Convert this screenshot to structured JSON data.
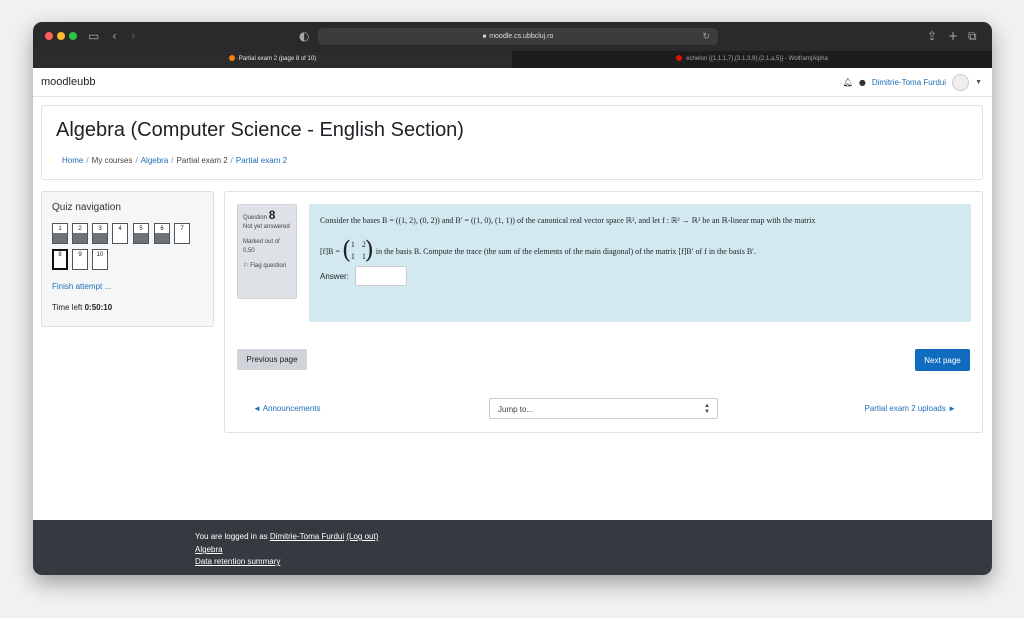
{
  "browser": {
    "url": "moodle.cs.ubbcluj.ro",
    "tabs": [
      {
        "label": "Partial exam 2 (page 8 of 10)",
        "active": true
      },
      {
        "label": "echelon {{1,1,1,7},{3,1,3,9},{2,1,a,5}} - Wolfram|Alpha",
        "active": false
      }
    ]
  },
  "navbar": {
    "brand": "moodleubb",
    "user_name": "Dimitrie-Toma Furdui"
  },
  "header": {
    "title": "Algebra (Computer Science - English Section)",
    "breadcrumb": {
      "home": "Home",
      "my_courses": "My courses",
      "course": "Algebra",
      "section": "Partial exam 2",
      "quiz": "Partial exam 2"
    }
  },
  "quiz_nav": {
    "title": "Quiz navigation",
    "questions": [
      {
        "number": "1",
        "answered": true
      },
      {
        "number": "2",
        "answered": true
      },
      {
        "number": "3",
        "answered": true
      },
      {
        "number": "4",
        "answered": false
      },
      {
        "number": "5",
        "answered": true
      },
      {
        "number": "6",
        "answered": true
      },
      {
        "number": "7",
        "answered": false
      },
      {
        "number": "8",
        "answered": false,
        "current": true
      },
      {
        "number": "9",
        "answered": false
      },
      {
        "number": "10",
        "answered": false
      }
    ],
    "finish_label": "Finish attempt ...",
    "time_left_label": "Time left",
    "time_left_value": "0:50:10"
  },
  "question": {
    "label": "Question",
    "number": "8",
    "status": "Not yet answered",
    "marked": "Marked out of 0,50",
    "flag": "Flag question",
    "text_line1": "Consider the bases B = ((1, 2), (0, 2)) and B′ = ((1, 0), (1, 1)) of the canonical real vector space ℝ², and let f : ℝ² → ℝ² be an ℝ-linear map with the matrix",
    "matrix_prefix": "[f]B =",
    "matrix": [
      [
        "1",
        "2"
      ],
      [
        "1",
        "1"
      ]
    ],
    "text_line2": "in the basis B. Compute the trace (the sum of the elements of the main diagonal) of the matrix [f]B′ of f in the basis B′.",
    "answer_label": "Answer:",
    "answer_value": ""
  },
  "navigation": {
    "previous_page": "Previous page",
    "next_page": "Next page",
    "prev_activity": "◄ Announcements",
    "jump_to": "Jump to...",
    "next_activity": "Partial exam 2 uploads ►"
  },
  "footer": {
    "logged_in_prefix": "You are logged in as",
    "user_name": "Dimitrie-Toma Furdui",
    "logout": "(Log out)",
    "course_link": "Algebra",
    "data_retention": "Data retention summary"
  },
  "colors": {
    "accent": "#0f6cbf",
    "question_bg": "#d2e9ef",
    "footer_bg": "#343a40"
  }
}
